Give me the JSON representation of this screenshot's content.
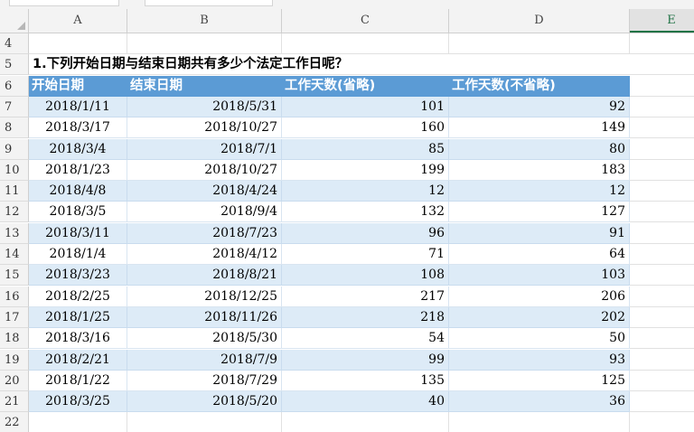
{
  "columns": [
    {
      "letter": "A",
      "left": 0
    },
    {
      "letter": "B"
    },
    {
      "letter": "C"
    },
    {
      "letter": "D"
    },
    {
      "letter": "E",
      "active": true
    }
  ],
  "title_row": {
    "row_number": "5",
    "text": "1.下列开始日期与结束日期共有多少个法定工作日呢？"
  },
  "header_row": {
    "row_number": "6",
    "cells": [
      "开始日期",
      "结束日期",
      "工作天数(省略)",
      "工作天数(不省略)"
    ]
  },
  "blank_rows": {
    "top": "4",
    "bottom": "22"
  },
  "rows": [
    {
      "n": "7",
      "start": "2018/1/11",
      "end": "2018/5/31",
      "omit": "101",
      "full": "92"
    },
    {
      "n": "8",
      "start": "2018/3/17",
      "end": "2018/10/27",
      "omit": "160",
      "full": "149"
    },
    {
      "n": "9",
      "start": "2018/3/4",
      "end": "2018/7/1",
      "omit": "85",
      "full": "80"
    },
    {
      "n": "10",
      "start": "2018/1/23",
      "end": "2018/10/27",
      "omit": "199",
      "full": "183"
    },
    {
      "n": "11",
      "start": "2018/4/8",
      "end": "2018/4/24",
      "omit": "12",
      "full": "12"
    },
    {
      "n": "12",
      "start": "2018/3/5",
      "end": "2018/9/4",
      "omit": "132",
      "full": "127"
    },
    {
      "n": "13",
      "start": "2018/3/11",
      "end": "2018/7/23",
      "omit": "96",
      "full": "91"
    },
    {
      "n": "14",
      "start": "2018/1/4",
      "end": "2018/4/12",
      "omit": "71",
      "full": "64"
    },
    {
      "n": "15",
      "start": "2018/3/23",
      "end": "2018/8/21",
      "omit": "108",
      "full": "103"
    },
    {
      "n": "16",
      "start": "2018/2/25",
      "end": "2018/12/25",
      "omit": "217",
      "full": "206"
    },
    {
      "n": "17",
      "start": "2018/1/25",
      "end": "2018/11/26",
      "omit": "218",
      "full": "202"
    },
    {
      "n": "18",
      "start": "2018/3/16",
      "end": "2018/5/30",
      "omit": "54",
      "full": "50"
    },
    {
      "n": "19",
      "start": "2018/2/21",
      "end": "2018/7/9",
      "omit": "99",
      "full": "93"
    },
    {
      "n": "20",
      "start": "2018/1/22",
      "end": "2018/7/29",
      "omit": "135",
      "full": "125"
    },
    {
      "n": "21",
      "start": "2018/3/25",
      "end": "2018/5/20",
      "omit": "40",
      "full": "36"
    }
  ],
  "colors": {
    "header_fill": "#5b9bd5",
    "band_fill": "#ddebf7",
    "active_col": "#217346"
  }
}
